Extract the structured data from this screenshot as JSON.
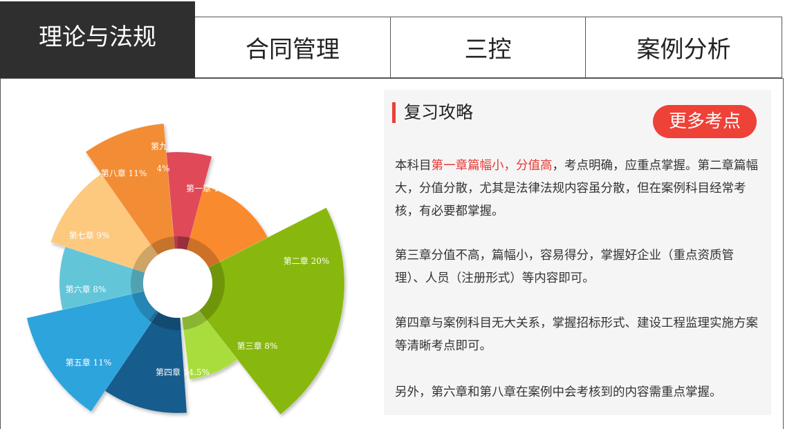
{
  "tabs": [
    {
      "label": "理论与法规",
      "active": true
    },
    {
      "label": "合同管理",
      "active": false
    },
    {
      "label": "三控",
      "active": false
    },
    {
      "label": "案例分析",
      "active": false
    }
  ],
  "panel": {
    "title": "复习攻略",
    "more_button": "更多考点",
    "paragraph1": {
      "prefix": "本科目",
      "highlight": "第一章篇幅小，分值高",
      "suffix": "，考点明确，应重点掌握。第二章篇幅大，分值分散，尤其是法律法规内容虽分散，但在案例科目经常考核，有必要都掌握。"
    },
    "paragraph2": "第三章分值不高，篇幅小，容易得分，掌握好企业（重点资质管理）、人员（注册形式）等内容即可。",
    "paragraph3": "第四章与案例科目无大关系，掌握招标形式、建设工程监理实施方案等清晰考点即可。",
    "paragraph4": "另外，第六章和第八章在案例中会考核到的内容需重点掌握。",
    "accent_color": "#ee4137"
  },
  "chart_data": {
    "type": "pie",
    "variant": "rose",
    "categories": [
      "第一章",
      "第二章",
      "第三章",
      "第四章",
      "第五章",
      "第六章",
      "第七章",
      "第八章",
      "第九章"
    ],
    "values": [
      14.5,
      20,
      8,
      14.5,
      11,
      8,
      9,
      11,
      4
    ],
    "labels": [
      "第一章 14.5%",
      "第二章 20%",
      "第三章 8%",
      "第四章 14.5%",
      "第五章 11%",
      "第六章 8%",
      "第七章 9%",
      "第八章 11%",
      "第九章 4%"
    ],
    "colors": [
      "#f98a2e",
      "#88b810",
      "#a8dd3c",
      "#135b8c",
      "#2ea4dd",
      "#64c5d8",
      "#fcc97e",
      "#f28d35",
      "#e04a58"
    ]
  }
}
